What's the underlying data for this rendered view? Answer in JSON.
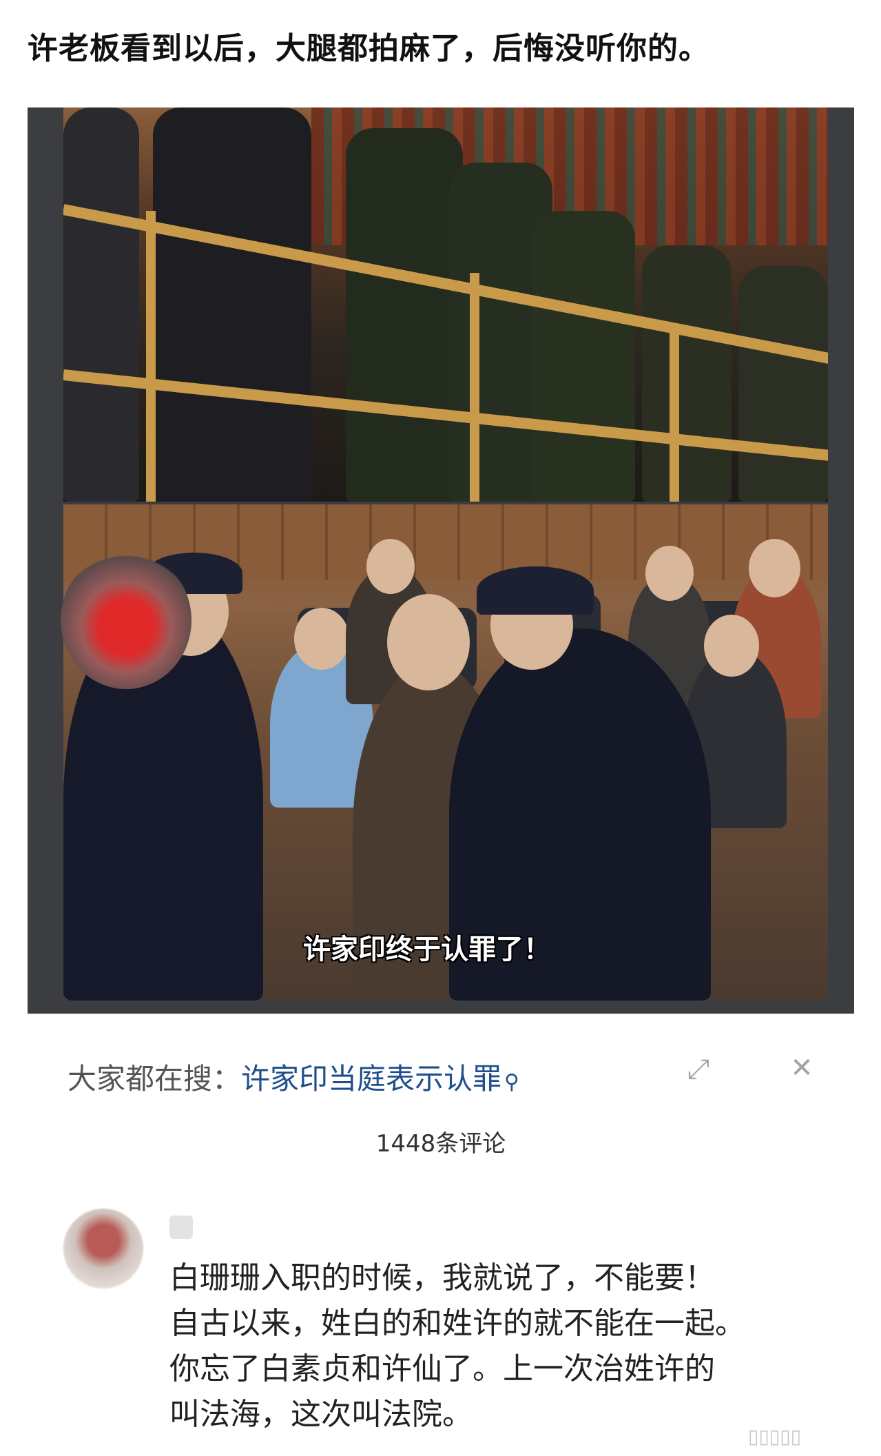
{
  "post": {
    "title": "许老板看到以后，大腿都拍麻了，后悔没听你的。"
  },
  "video": {
    "caption": "许家印终于认罪了！"
  },
  "search_bar": {
    "prefix": "大家都在搜：",
    "term": "许家印当庭表示认罪",
    "search_icon": "search-icon",
    "expand_icon": "expand-icon",
    "close_icon": "close-icon"
  },
  "comments": {
    "count_label": "1448条评论",
    "items": [
      {
        "lines": [
          "白珊珊入职的时候，我就说了，不能要！",
          "自古以来，姓白的和姓许的就不能在一起。",
          "你忘了白素贞和许仙了。上一次治姓许的",
          "叫法海，这次叫法院。"
        ]
      }
    ]
  },
  "colors": {
    "accent_link": "#1f4e8c",
    "frame_bg": "#3b3d40"
  }
}
